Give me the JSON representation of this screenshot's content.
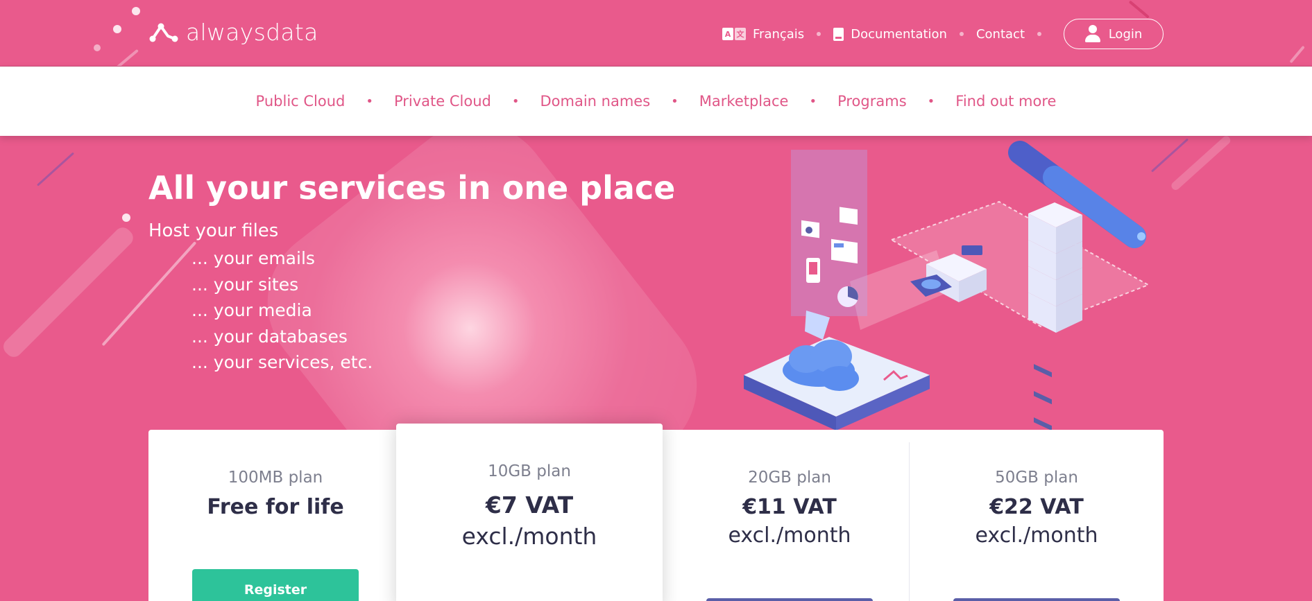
{
  "brand": {
    "name": "alwaysdata",
    "primary_color": "#e95a8c",
    "accent_green": "#2dc39a",
    "accent_purple": "#5a5ea8"
  },
  "topnav": {
    "language": {
      "label": "Français",
      "icon": "translate-icon"
    },
    "documentation": {
      "label": "Documentation",
      "icon": "book-icon"
    },
    "contact": {
      "label": "Contact"
    },
    "login": {
      "label": "Login",
      "icon": "user-icon"
    }
  },
  "subnav": {
    "items": [
      "Public Cloud",
      "Private Cloud",
      "Domain names",
      "Marketplace",
      "Programs",
      "Find out more"
    ],
    "separator": "•"
  },
  "hero": {
    "title": "All your services in one place",
    "subtitle": "Host your files",
    "list": [
      "... your emails",
      "... your sites",
      "... your media",
      "... your databases",
      "... your services, etc."
    ]
  },
  "plans": [
    {
      "name": "100MB plan",
      "price": "Free for life",
      "price_sub": "",
      "button": "Register"
    },
    {
      "name": "10GB plan",
      "price": "€7 VAT",
      "price_sub": "excl./month",
      "featured": true
    },
    {
      "name": "20GB plan",
      "price": "€11 VAT",
      "price_sub": "excl./month"
    },
    {
      "name": "50GB plan",
      "price": "€22 VAT",
      "price_sub": "excl./month"
    }
  ]
}
